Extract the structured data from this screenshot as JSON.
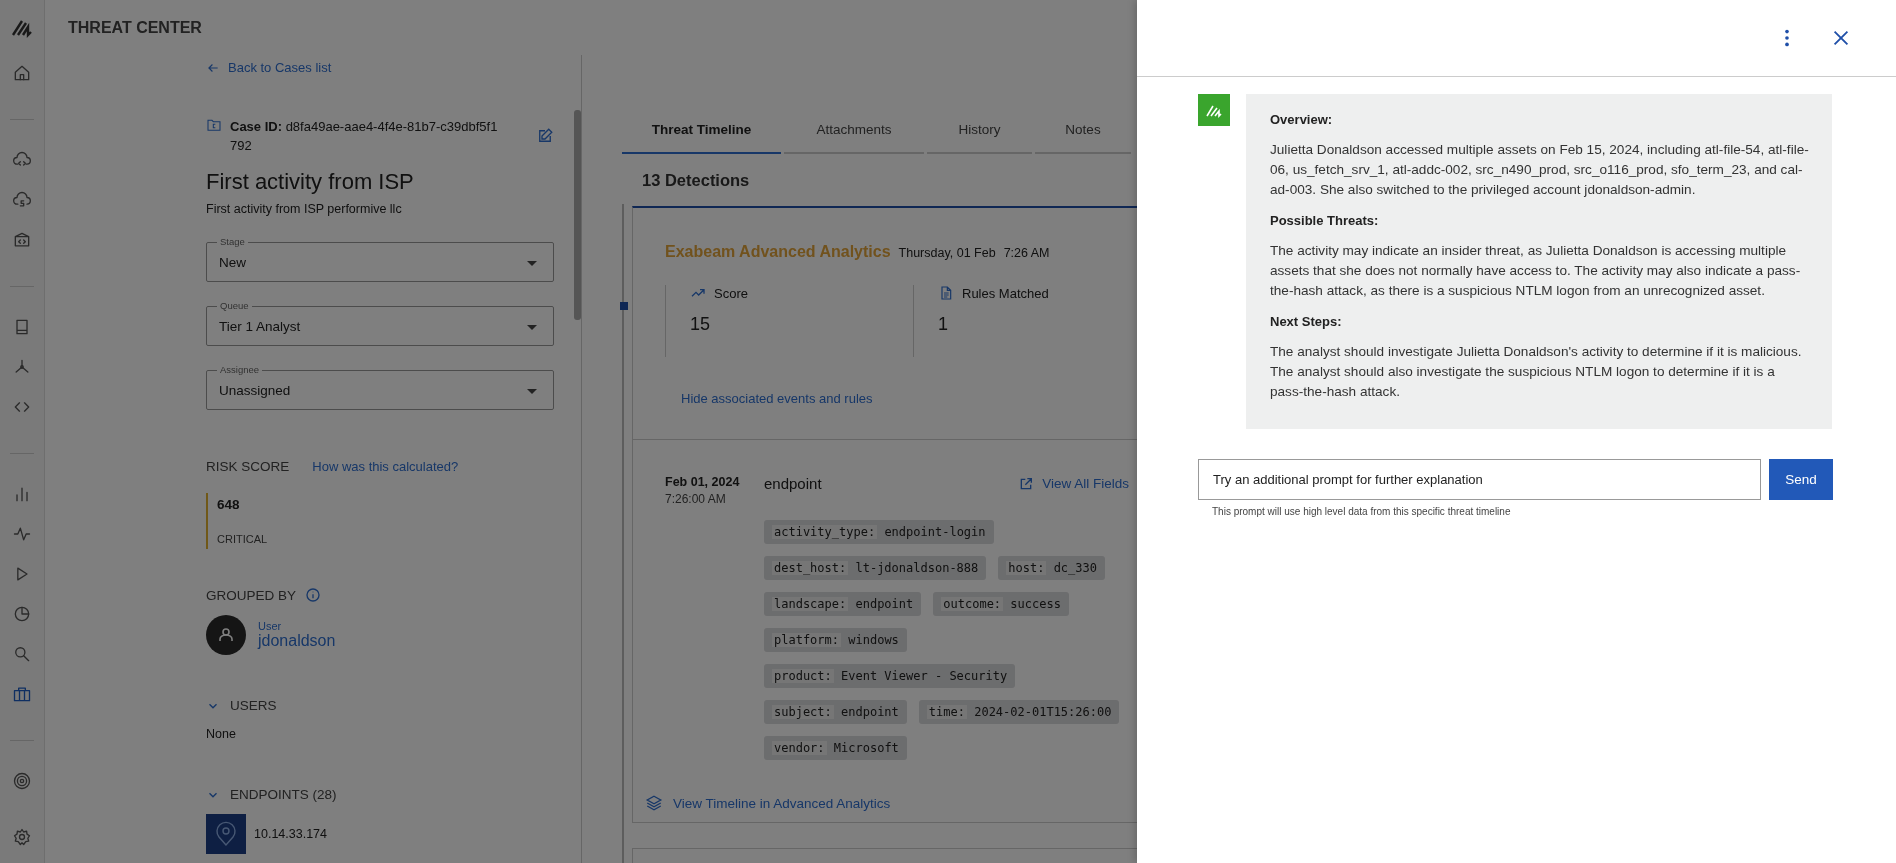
{
  "app": {
    "title": "THREAT CENTER"
  },
  "sidebar": {
    "items": [
      {
        "selected": false
      },
      {
        "selected": false
      },
      {
        "selected": false
      },
      {
        "selected": false
      },
      {
        "selected": false
      },
      {
        "selected": false
      },
      {
        "selected": false
      },
      {
        "selected": false
      },
      {
        "selected": false
      },
      {
        "selected": false
      },
      {
        "selected": false
      },
      {
        "selected": false
      },
      {
        "selected": true
      },
      {
        "selected": false
      },
      {
        "selected": false
      }
    ]
  },
  "case": {
    "back_link": "Back to Cases list",
    "id_label": "Case ID:",
    "id": "d8fa49ae-aae4-4f4e-81b7-c39dbf5f1792",
    "title": "First activity from ISP",
    "subtitle": "First activity from ISP performive llc",
    "fields": [
      {
        "label": "Stage",
        "value": "New"
      },
      {
        "label": "Queue",
        "value": "Tier 1 Analyst"
      },
      {
        "label": "Assignee",
        "value": "Unassigned"
      }
    ],
    "risk": {
      "heading": "RISK SCORE",
      "link": "How was this calculated?",
      "score": "648",
      "level": "CRITICAL"
    },
    "grouped_by": {
      "heading": "GROUPED BY",
      "type": "User",
      "name": "jdonaldson"
    },
    "users": {
      "heading": "USERS",
      "expanded": true,
      "empty": "None"
    },
    "endpoints": {
      "heading": "ENDPOINTS (28)",
      "expanded": true,
      "items": [
        "10.14.33.174"
      ]
    }
  },
  "tabs": [
    {
      "label": "Threat Timeline",
      "selected": true
    },
    {
      "label": "Attachments",
      "selected": false
    },
    {
      "label": "History",
      "selected": false
    },
    {
      "label": "Notes",
      "selected": false
    }
  ],
  "detections": {
    "title": "13 Detections",
    "source": "Exabeam Advanced Analytics",
    "date": "Thursday, 01 Feb",
    "time": "7:26 AM",
    "metrics": [
      {
        "label": "Score",
        "value": "15"
      },
      {
        "label": "Rules Matched",
        "value": "1"
      }
    ],
    "toggle_link": "Hide associated events and rules",
    "event": {
      "date": "Feb 01, 2024",
      "time": "7:26:00 AM",
      "type": "endpoint",
      "fields_link": "View All Fields",
      "fields": [
        [
          {
            "key": "activity_type:",
            "value": "endpoint-login"
          }
        ],
        [
          {
            "key": "dest_host:",
            "value": "lt-jdonaldson-888"
          },
          {
            "key": "host:",
            "value": "dc_330"
          }
        ],
        [
          {
            "key": "landscape:",
            "value": "endpoint"
          },
          {
            "key": "outcome:",
            "value": "success"
          }
        ],
        [
          {
            "key": "platform:",
            "value": "windows"
          }
        ],
        [
          {
            "key": "product:",
            "value": "Event Viewer - Security"
          }
        ],
        [
          {
            "key": "subject:",
            "value": "endpoint"
          },
          {
            "key": "time:",
            "value": "2024-02-01T15:26:00"
          }
        ],
        [
          {
            "key": "vendor:",
            "value": "Microsoft"
          }
        ]
      ]
    },
    "timeline_link": "View Timeline in Advanced Analytics"
  },
  "assistant": {
    "sections": [
      {
        "heading": "Overview:",
        "text": "Julietta Donaldson accessed multiple assets on Feb 15, 2024, including atl-file-54, atl-file-06, us_fetch_srv_1, atl-addc-002, src_n490_prod, src_o116_prod, sfo_term_23, and cal-ad-003. She also switched to the privileged account jdonaldson-admin."
      },
      {
        "heading": "Possible Threats:",
        "text": "The activity may indicate an insider threat, as Julietta Donaldson is accessing multiple assets that she does not normally have access to. The activity may also indicate a pass-the-hash attack, as there is a suspicious NTLM logon from an unrecognized asset."
      },
      {
        "heading": "Next Steps:",
        "text": "The analyst should investigate Julietta Donaldson's activity to determine if it is malicious. The analyst should also investigate the suspicious NTLM logon to determine if it is a pass-the-hash attack."
      }
    ],
    "prompt": {
      "placeholder": "Try an additional prompt for further explanation"
    },
    "send": "Send",
    "hint": "This prompt will use high level data from this specific threat timeline"
  }
}
